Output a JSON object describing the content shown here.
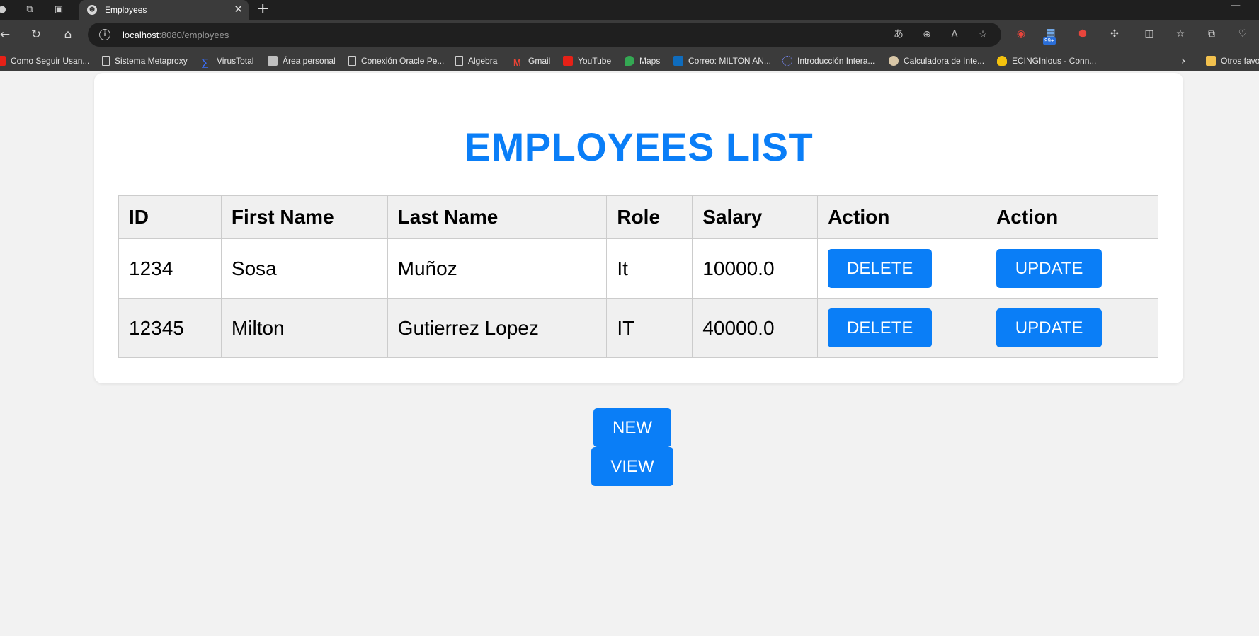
{
  "browser": {
    "tab": {
      "title": "Employees"
    },
    "address": {
      "host": "localhost",
      "rest": ":8080/employees"
    },
    "bookmarks": [
      {
        "label": "Como Seguir Usan...",
        "icon": "youtube-icon"
      },
      {
        "label": "Sistema Metaproxy",
        "icon": "document-icon"
      },
      {
        "label": "VirusTotal",
        "icon": "virustotal-icon"
      },
      {
        "label": "Área personal",
        "icon": "moodle-icon"
      },
      {
        "label": "Conexión Oracle Pe...",
        "icon": "document-icon"
      },
      {
        "label": "Algebra",
        "icon": "document-icon"
      },
      {
        "label": "Gmail",
        "icon": "gmail-icon"
      },
      {
        "label": "YouTube",
        "icon": "youtube-icon"
      },
      {
        "label": "Maps",
        "icon": "maps-icon"
      },
      {
        "label": "Correo: MILTON AN...",
        "icon": "outlook-icon"
      },
      {
        "label": "Introducción Intera...",
        "icon": "loading-icon"
      },
      {
        "label": "Calculadora de Inte...",
        "icon": "calculator-icon"
      },
      {
        "label": "ECINGInious - Conn...",
        "icon": "lightbulb-icon"
      },
      {
        "label": "Otros favoritos",
        "icon": "folder-icon"
      }
    ],
    "extension_badge": "99+"
  },
  "page": {
    "title": "EMPLOYEES LIST",
    "table": {
      "headers": [
        "ID",
        "First Name",
        "Last Name",
        "Role",
        "Salary",
        "Action",
        "Action"
      ],
      "rows": [
        {
          "id": "1234",
          "first_name": "Sosa",
          "last_name": "Muñoz",
          "role": "It",
          "salary": "10000.0",
          "delete_label": "DELETE",
          "update_label": "UPDATE"
        },
        {
          "id": "12345",
          "first_name": "Milton",
          "last_name": "Gutierrez Lopez",
          "role": "IT",
          "salary": "40000.0",
          "delete_label": "DELETE",
          "update_label": "UPDATE"
        }
      ]
    },
    "new_label": "NEW",
    "view_label": "VIEW"
  },
  "colors": {
    "accent": "#0a7ef7",
    "page_background": "#f2f2f2",
    "card_background": "#ffffff",
    "header_row_background": "#f0f0f0",
    "browser_dark": "#1f1f1f",
    "browser_toolbar": "#3b3b3b"
  }
}
